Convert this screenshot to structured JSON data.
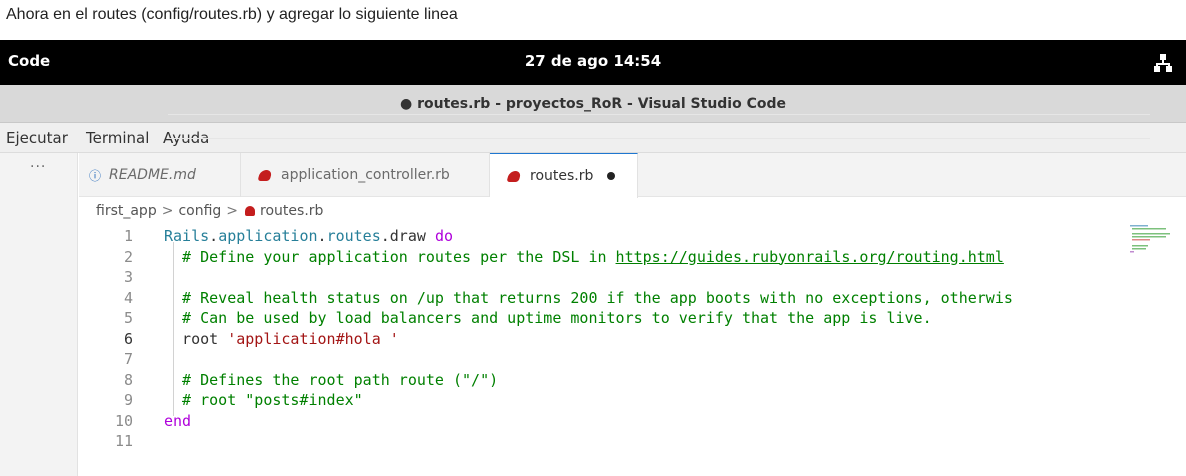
{
  "top_strip": {
    "text": "Ahora en el routes (config/routes.rb) y agregar lo siguiente linea"
  },
  "gnome_bar": {
    "app_name": "Code",
    "clock": "27 de ago  14:54",
    "network_icon": "network-icon"
  },
  "window": {
    "title": "● routes.rb - proyectos_RoR - Visual Studio Code"
  },
  "menu": [
    "Ejecutar",
    "Terminal",
    "Ayuda"
  ],
  "activity": {
    "more_label": "···"
  },
  "tabs": [
    {
      "label": "README.md",
      "icon": "info-icon",
      "italic": true
    },
    {
      "label": "application_controller.rb",
      "icon": "ruby-icon"
    },
    {
      "label": "routes.rb",
      "icon": "ruby-icon",
      "active": true,
      "dirty": true
    }
  ],
  "breadcrumb": {
    "items": [
      "first_app",
      "config",
      "routes.rb"
    ],
    "separator": ">"
  },
  "editor": {
    "language": "ruby",
    "current_line": 6,
    "lines": [
      {
        "n": "1",
        "parts": [
          [
            "cl",
            "Rails"
          ],
          [
            "",
            "."
          ],
          [
            "cl",
            "application"
          ],
          [
            "",
            "."
          ],
          [
            "cl",
            "routes"
          ],
          [
            "",
            "."
          ],
          [
            "",
            "draw "
          ],
          [
            "k",
            "do"
          ]
        ]
      },
      {
        "n": "2",
        "parts": [
          [
            "c",
            "  # Define your application routes per the DSL in "
          ],
          [
            "link",
            "https://guides.rubyonrails.org/routing.html"
          ]
        ]
      },
      {
        "n": "3",
        "parts": []
      },
      {
        "n": "4",
        "parts": [
          [
            "c",
            "  # Reveal health status on /up that returns 200 if the app boots with no exceptions, otherwis"
          ]
        ]
      },
      {
        "n": "5",
        "parts": [
          [
            "c",
            "  # Can be used by load balancers and uptime monitors to verify that the app is live."
          ]
        ]
      },
      {
        "n": "6",
        "parts": [
          [
            "",
            "  root "
          ],
          [
            "s",
            "'application#hola '"
          ]
        ]
      },
      {
        "n": "7",
        "parts": []
      },
      {
        "n": "8",
        "parts": [
          [
            "c",
            "  # Defines the root path route (\"/\")"
          ]
        ]
      },
      {
        "n": "9",
        "parts": [
          [
            "c",
            "  # root \"posts#index\""
          ]
        ]
      },
      {
        "n": "10",
        "parts": [
          [
            "k",
            "end"
          ]
        ]
      },
      {
        "n": "11",
        "parts": []
      }
    ]
  }
}
